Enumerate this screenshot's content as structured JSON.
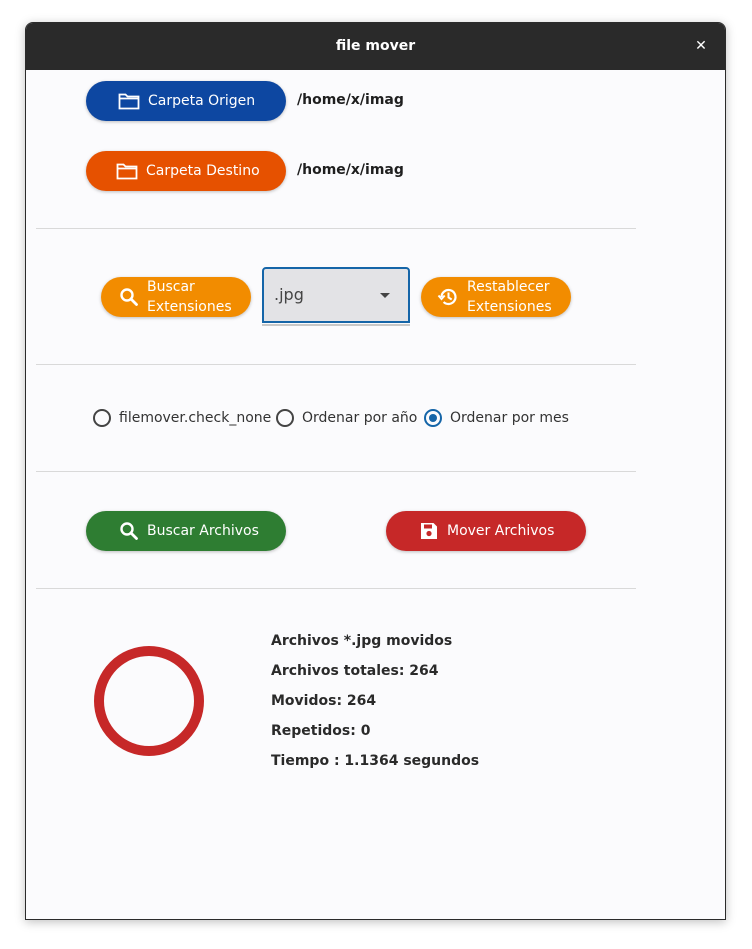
{
  "window": {
    "title": "file mover",
    "close_label": "✕"
  },
  "folders": {
    "source_button": "Carpeta Origen",
    "source_path": "/home/x/imag",
    "dest_button": "Carpeta Destino",
    "dest_path": "/home/x/imag"
  },
  "extensions": {
    "search_button": [
      "Buscar",
      "Extensiones"
    ],
    "selected": ".jpg",
    "reset_button": [
      "Restablecer",
      "Extensiones"
    ]
  },
  "sort_options": [
    {
      "label": "filemover.check_none",
      "selected": false
    },
    {
      "label": "Ordenar por año",
      "selected": false
    },
    {
      "label": "Ordenar por mes",
      "selected": true
    }
  ],
  "actions": {
    "search_files": "Buscar Archivos",
    "move_files": "Mover Archivos"
  },
  "results": {
    "line1": "Archivos *.jpg movidos",
    "line2": "Archivos totales: 264",
    "line3": "Movidos: 264",
    "line4": "Repetidos: 0",
    "line5": "Tiempo : 1.1364 segundos"
  },
  "colors": {
    "source": "#0d47a1",
    "dest": "#e65100",
    "ext": "#f28c00",
    "search_files": "#2e7d32",
    "move_files": "#c62828",
    "progress": "#c62828"
  }
}
